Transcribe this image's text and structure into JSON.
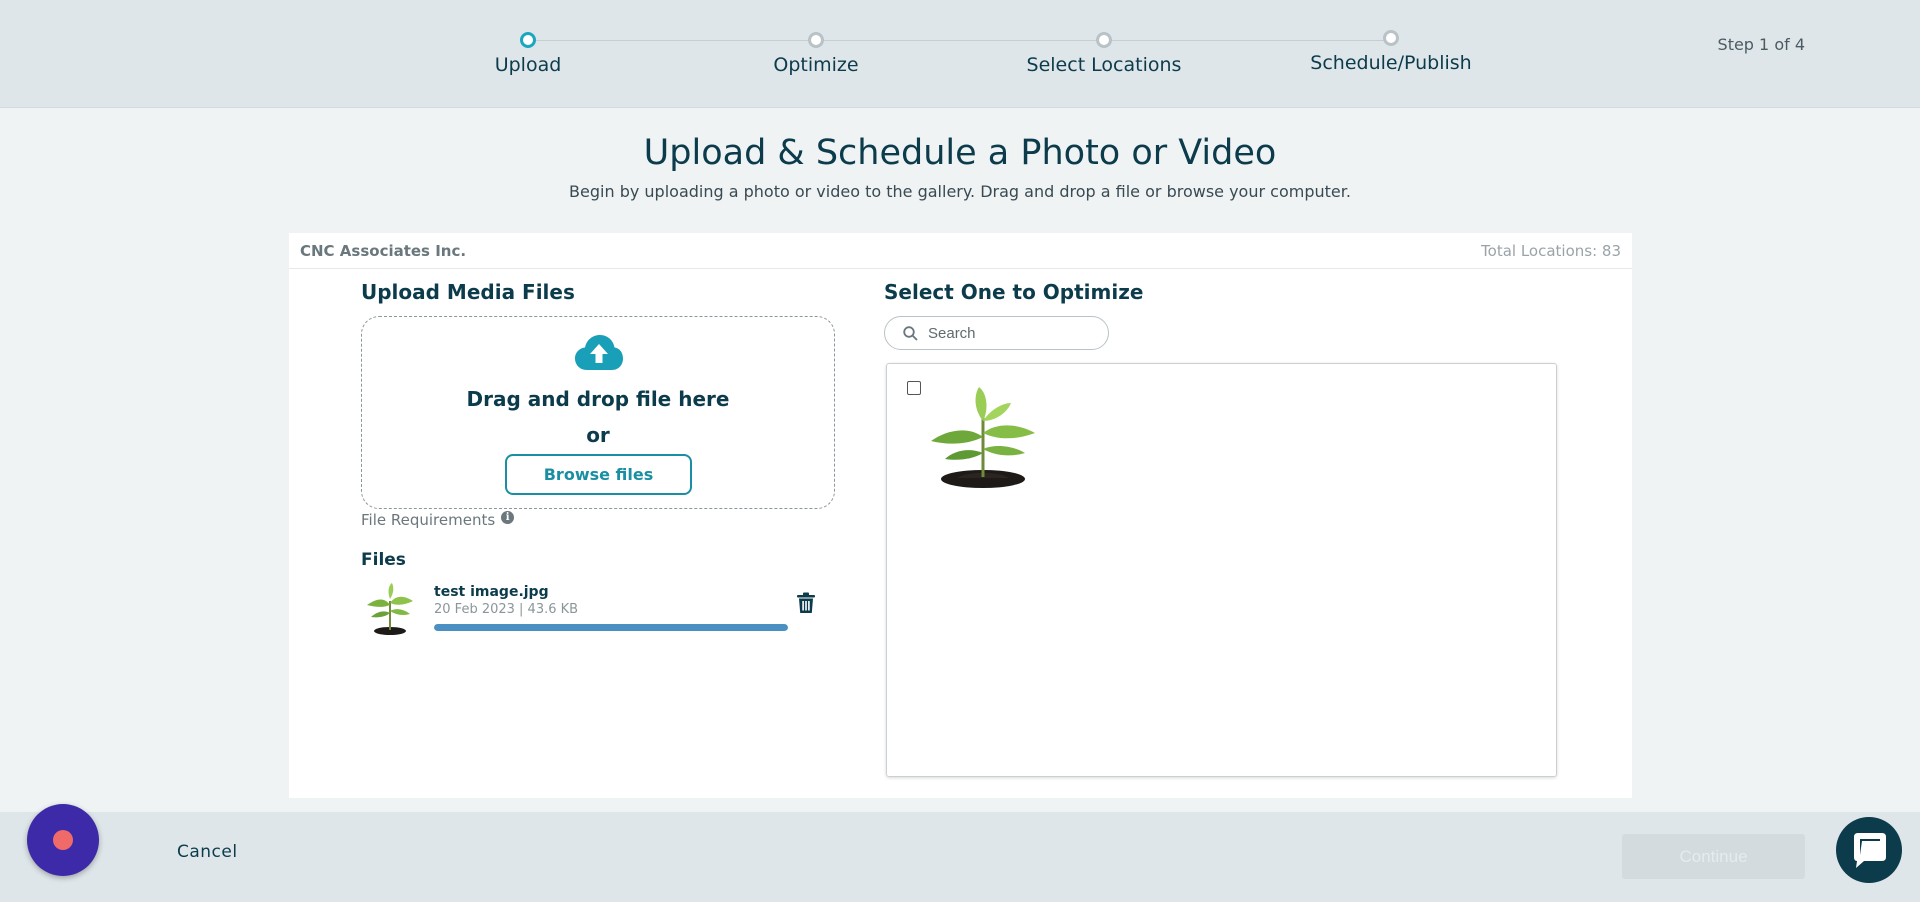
{
  "stepper": {
    "steps": [
      {
        "label": "Upload",
        "active": true
      },
      {
        "label": "Optimize",
        "active": false
      },
      {
        "label": "Select Locations",
        "active": false
      },
      {
        "label": "Schedule/Publish",
        "active": false
      }
    ],
    "counter": "Step 1 of 4"
  },
  "heading": {
    "title": "Upload & Schedule a Photo or Video",
    "subtitle": "Begin by uploading a photo or video to the gallery. Drag and drop a file or browse your computer."
  },
  "card": {
    "company": "CNC Associates Inc.",
    "total_locations": "Total Locations: 83"
  },
  "upload": {
    "title": "Upload Media Files",
    "drag_text": "Drag and drop file here",
    "or_text": "or",
    "browse_label": "Browse files",
    "requirements_label": "File Requirements",
    "files_title": "Files",
    "files": [
      {
        "name": "test image.jpg",
        "meta": "20 Feb 2023 |  43.6 KB",
        "progress": 1.0
      }
    ]
  },
  "optimize": {
    "title": "Select One to Optimize",
    "search_placeholder": "Search"
  },
  "footer": {
    "cancel_label": "Cancel",
    "continue_label": "Continue"
  },
  "colors": {
    "accent": "#1aa7bf",
    "brand_dark": "#0c3b4c",
    "progress": "#4a90c2",
    "record": "#3c2aa8"
  },
  "icons": {
    "upload": "cloud-upload-icon",
    "info": "info-icon",
    "delete": "trash-icon",
    "search": "search-icon",
    "chat": "chat-icon",
    "record": "record-icon"
  }
}
